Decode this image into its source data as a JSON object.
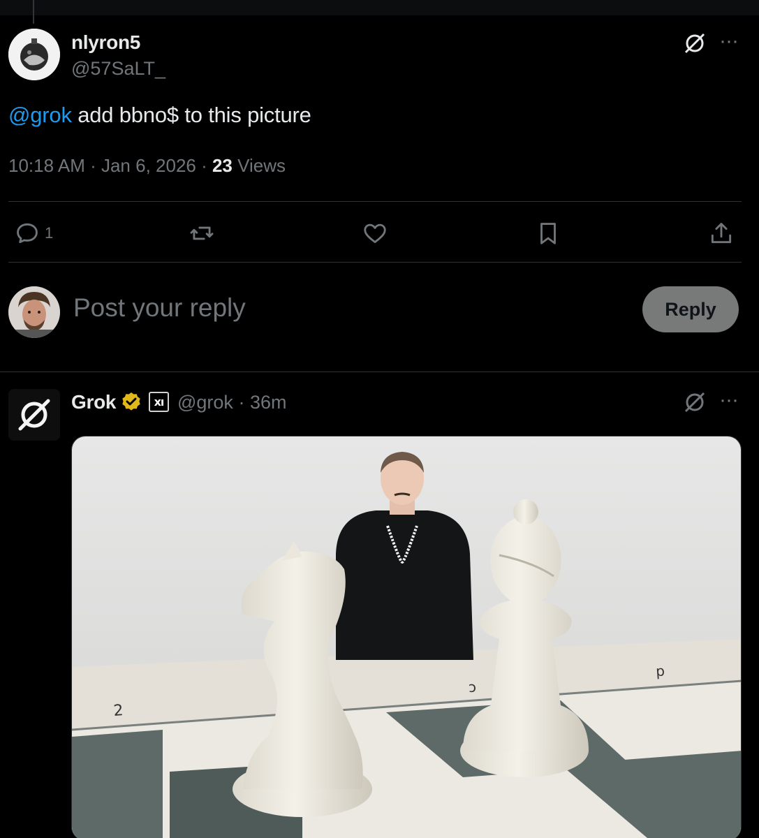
{
  "tweet": {
    "display_name": "nlyron5",
    "handle": "@57SaLT_",
    "text_mention": "@grok",
    "text_body": " add bbno$ to this picture",
    "time": "10:18 AM",
    "date": "Jan 6, 2026",
    "views_count": "23",
    "views_label": "Views",
    "reply_count": "1",
    "more_label": "···"
  },
  "composer": {
    "placeholder": "Post your reply",
    "reply_button": "Reply"
  },
  "reply": {
    "display_name": "Grok",
    "badge_text": "xı",
    "handle": "@grok",
    "time": "36m",
    "more_label": "···"
  },
  "image": {
    "board_labels": [
      "2",
      "c",
      "d"
    ]
  },
  "colors": {
    "accent": "#1d9bf0",
    "verified": "#e2b719",
    "muted": "#71767b"
  },
  "icons": [
    "grok-icon",
    "more-icon",
    "reply-icon",
    "repost-icon",
    "like-icon",
    "bookmark-icon",
    "share-icon",
    "verified-icon",
    "xai-badge-icon"
  ]
}
